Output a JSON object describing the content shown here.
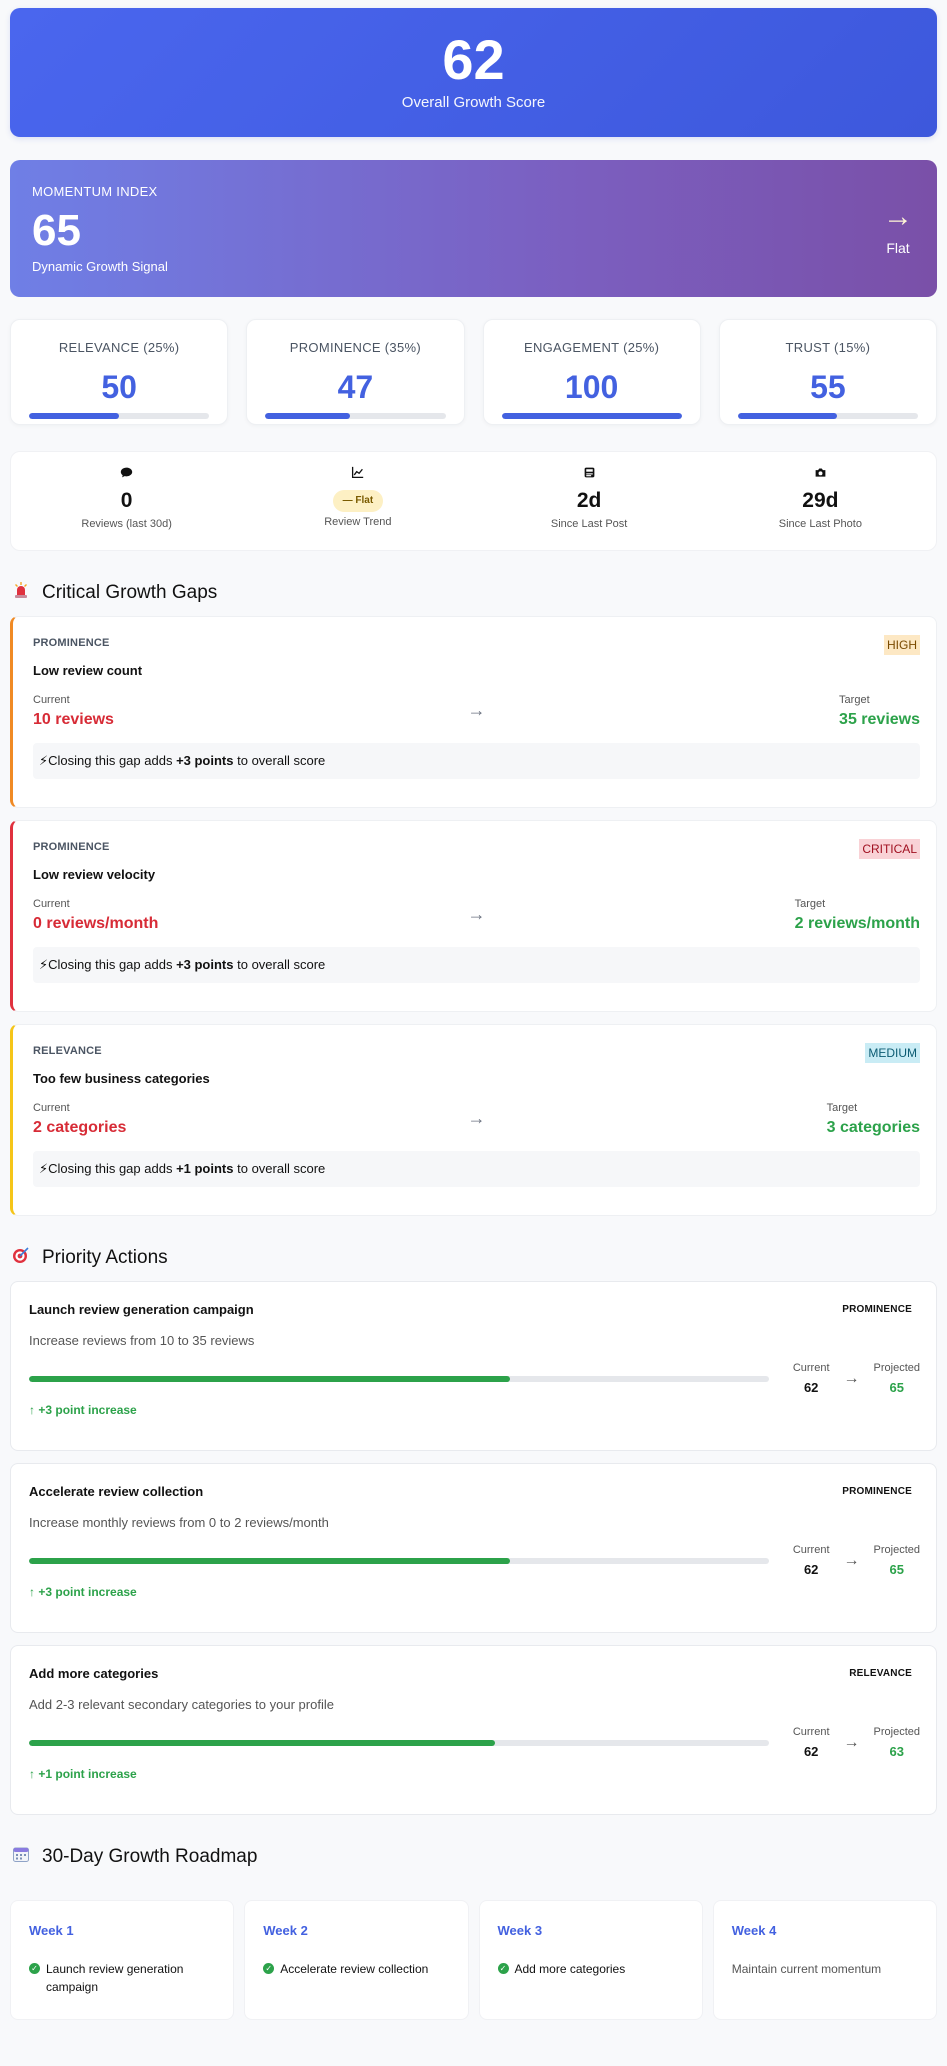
{
  "overall": {
    "score": "62",
    "label": "Overall Growth Score"
  },
  "momentum": {
    "label": "MOMENTUM INDEX",
    "value": "65",
    "signal": "Dynamic Growth Signal",
    "trend": "Flat"
  },
  "factors": [
    {
      "name": "RELEVANCE (25%)",
      "value": "50",
      "percent": 50
    },
    {
      "name": "PROMINENCE (35%)",
      "value": "47",
      "percent": 47
    },
    {
      "name": "ENGAGEMENT (25%)",
      "value": "100",
      "percent": 100
    },
    {
      "name": "TRUST (15%)",
      "value": "55",
      "percent": 55
    }
  ],
  "stats": [
    {
      "value": "0",
      "label": "Reviews (last 30d)",
      "icon": "chat-bubble-icon"
    },
    {
      "pill": "— Flat",
      "label": "Review Trend",
      "icon": "trend-chart-icon"
    },
    {
      "value": "2d",
      "label": "Since Last Post",
      "icon": "newspaper-icon"
    },
    {
      "value": "29d",
      "label": "Since Last Photo",
      "icon": "camera-icon"
    }
  ],
  "gaps_section": {
    "title": "Critical Growth Gaps"
  },
  "gaps": [
    {
      "category": "PROMINENCE",
      "severity": "HIGH",
      "title": "Low review count",
      "current_label": "Current",
      "current": "10 reviews",
      "target_label": "Target",
      "target": "35 reviews",
      "note_prefix": "Closing this gap adds ",
      "note_points": "+3 points",
      "note_suffix": " to overall score"
    },
    {
      "category": "PROMINENCE",
      "severity": "CRITICAL",
      "title": "Low review velocity",
      "current_label": "Current",
      "current": "0 reviews/month",
      "target_label": "Target",
      "target": "2 reviews/month",
      "note_prefix": "Closing this gap adds ",
      "note_points": "+3 points",
      "note_suffix": " to overall score"
    },
    {
      "category": "RELEVANCE",
      "severity": "MEDIUM",
      "title": "Too few business categories",
      "current_label": "Current",
      "current": "2 categories",
      "target_label": "Target",
      "target": "3 categories",
      "note_prefix": "Closing this gap adds ",
      "note_points": "+1 points",
      "note_suffix": " to overall score"
    }
  ],
  "actions_section": {
    "title": "Priority Actions"
  },
  "actions": [
    {
      "title": "Launch review generation campaign",
      "category": "PROMINENCE",
      "desc": "Increase reviews from 10 to 35 reviews",
      "progress": 65,
      "current_label": "Current",
      "current": "62",
      "projected_label": "Projected",
      "projected": "65",
      "increase": "+3 point increase"
    },
    {
      "title": "Accelerate review collection",
      "category": "PROMINENCE",
      "desc": "Increase monthly reviews from 0 to 2 reviews/month",
      "progress": 65,
      "current_label": "Current",
      "current": "62",
      "projected_label": "Projected",
      "projected": "65",
      "increase": "+3 point increase"
    },
    {
      "title": "Add more categories",
      "category": "RELEVANCE",
      "desc": "Add 2-3 relevant secondary categories to your profile",
      "progress": 63,
      "current_label": "Current",
      "current": "62",
      "projected_label": "Projected",
      "projected": "63",
      "increase": "+1 point increase"
    }
  ],
  "roadmap_section": {
    "title": "30-Day Growth Roadmap"
  },
  "roadmap": [
    {
      "week": "Week 1",
      "item": "Launch review generation campaign",
      "done": true
    },
    {
      "week": "Week 2",
      "item": "Accelerate review collection",
      "done": true
    },
    {
      "week": "Week 3",
      "item": "Add more categories",
      "done": true
    },
    {
      "week": "Week 4",
      "item": "Maintain current momentum",
      "done": false
    }
  ],
  "colors": {
    "primary": "#4361e0",
    "danger": "#d72b36",
    "success": "#2ca24a",
    "high": "#f08a24",
    "critical": "#e0313e",
    "medium": "#f5c518"
  }
}
